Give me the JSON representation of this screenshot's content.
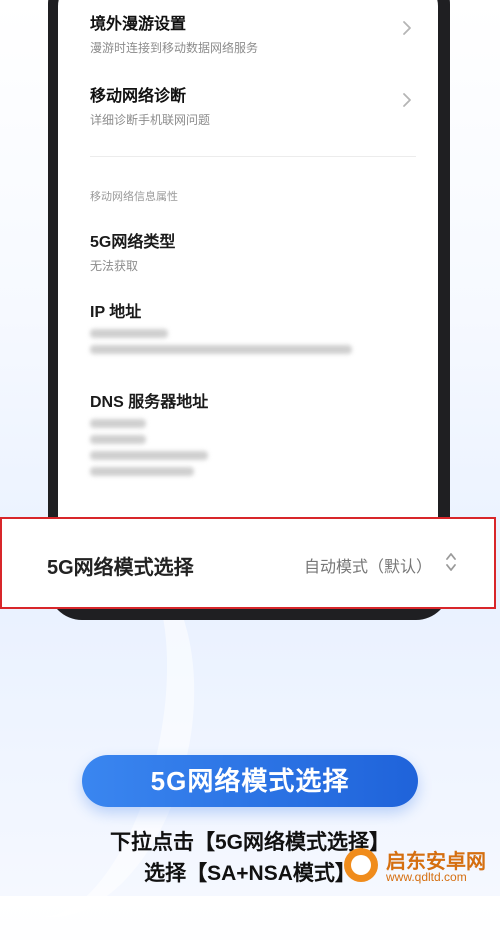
{
  "settings": {
    "roaming": {
      "title": "境外漫游设置",
      "subtitle": "漫游时连接到移动数据网络服务"
    },
    "diagnosis": {
      "title": "移动网络诊断",
      "subtitle": "详细诊断手机联网问题"
    },
    "section_label": "移动网络信息属性",
    "net_type": {
      "title": "5G网络类型",
      "value": "无法获取"
    },
    "ip": {
      "title": "IP 地址"
    },
    "dns": {
      "title": "DNS 服务器地址"
    }
  },
  "mode_select": {
    "label": "5G网络模式选择",
    "value": "自动模式（默认）"
  },
  "guide": {
    "button": "5G网络模式选择",
    "line1": "下拉点击【5G网络模式选择】",
    "line2": "选择【SA+NSA模式】"
  },
  "watermark": {
    "name": "启东安卓网",
    "url": "www.qdltd.com"
  }
}
